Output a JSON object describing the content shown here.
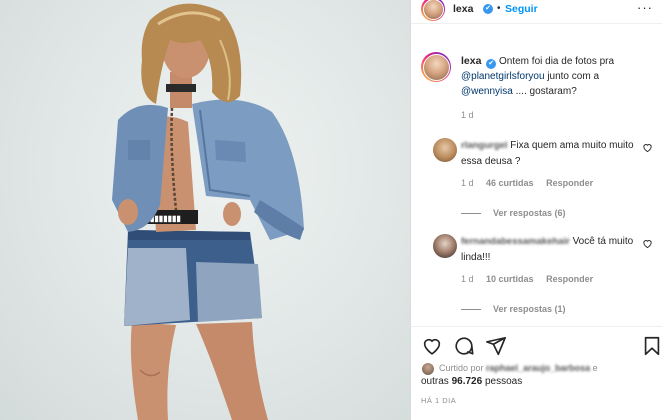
{
  "header": {
    "username": "lexa",
    "verified_badge": "✔",
    "separator": "•",
    "follow_label": "Seguir",
    "more_label": "···"
  },
  "caption": {
    "username": "lexa",
    "verified_badge": "✔",
    "text_1": "Ontem foi dia de fotos pra",
    "mention_1": "@planetgirlsforyou",
    "text_2": "junto com a",
    "mention_2": "@wennyisa",
    "text_3": ".... gostaram?",
    "time": "1 d"
  },
  "comments": [
    {
      "username": "rlangurgel",
      "text": "Fixa quem ama muito muito essa deusa ?",
      "time": "1 d",
      "likes": "46 curtidas",
      "reply_label": "Responder",
      "replies_label": "Ver respostas (6)"
    },
    {
      "username": "fernandabessamakehair",
      "text": "Você tá muito linda!!!",
      "time": "1 d",
      "likes": "10 curtidas",
      "reply_label": "Responder",
      "replies_label": "Ver respostas (1)"
    }
  ],
  "likes": {
    "liked_by_prefix": "Curtido por",
    "liked_by_user": "raphael_araujo_barbosa",
    "liked_by_joiner": "e",
    "others_prefix": "outras",
    "others_count": "96.726",
    "others_suffix": "pessoas"
  },
  "posted_time": "HÁ 1 DIA",
  "icons": {
    "like": "heart-icon",
    "comment": "comment-icon",
    "share": "paper-plane-icon",
    "save": "bookmark-icon"
  },
  "colors": {
    "link_blue": "#0095f6",
    "mention_blue": "#00376b",
    "muted": "#8e8e8e"
  }
}
